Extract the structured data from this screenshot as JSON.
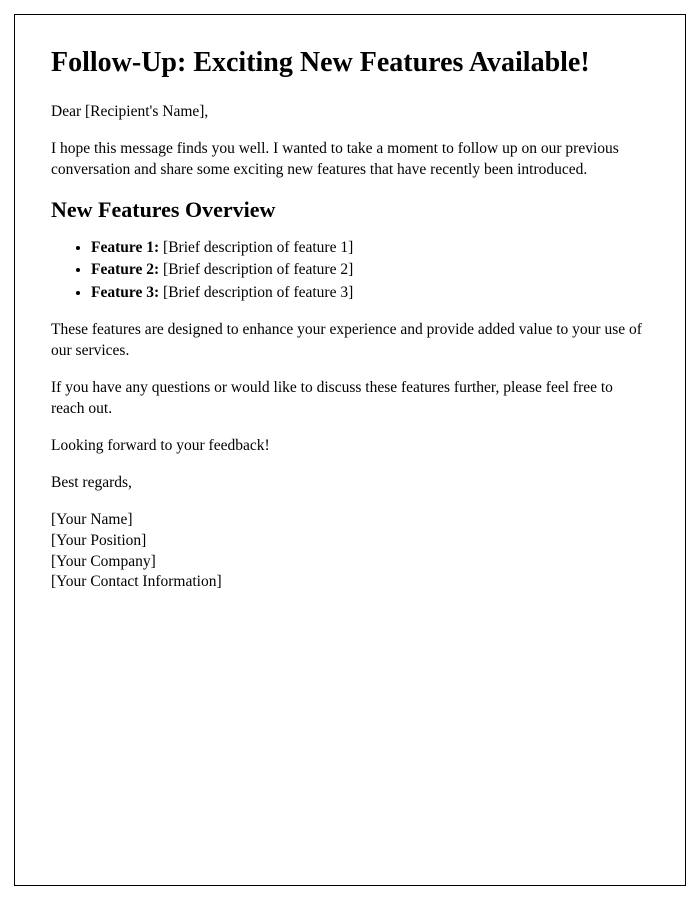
{
  "title": "Follow-Up: Exciting New Features Available!",
  "greeting": "Dear [Recipient's Name],",
  "intro": "I hope this message finds you well. I wanted to take a moment to follow up on our previous conversation and share some exciting new features that have recently been introduced.",
  "section_heading": "New Features Overview",
  "features": [
    {
      "label": "Feature 1:",
      "desc": "[Brief description of feature 1]"
    },
    {
      "label": "Feature 2:",
      "desc": "[Brief description of feature 2]"
    },
    {
      "label": "Feature 3:",
      "desc": "[Brief description of feature 3]"
    }
  ],
  "para_value": "These features are designed to enhance your experience and provide added value to your use of our services.",
  "para_questions": "If you have any questions or would like to discuss these features further, please feel free to reach out.",
  "para_feedback": "Looking forward to your feedback!",
  "closing": "Best regards,",
  "signature": {
    "name": "[Your Name]",
    "position": "[Your Position]",
    "company": "[Your Company]",
    "contact": "[Your Contact Information]"
  }
}
